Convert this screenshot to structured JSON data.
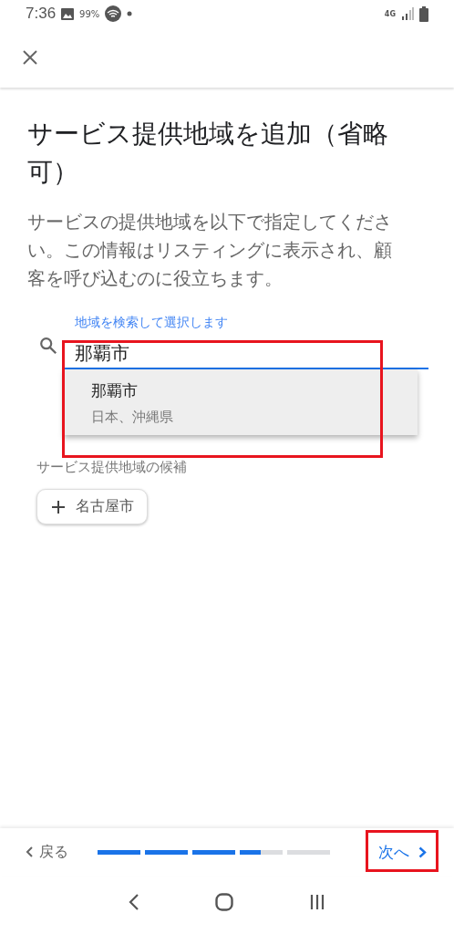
{
  "status_bar": {
    "time": "7:36",
    "battery_saver": "99%",
    "network": "4G"
  },
  "title": "サービス提供地域を追加（省略可）",
  "description": "サービスの提供地域を以下で指定してください。この情報はリスティングに表示され、顧客を呼び込むのに役立ちます。",
  "search": {
    "label": "地域を検索して選択します",
    "value": "那覇市",
    "highlighted": true,
    "suggestions": [
      {
        "name": "那覇市",
        "region": "日本、沖縄県"
      }
    ]
  },
  "candidates": {
    "heading": "サービス提供地域の候補",
    "chips": [
      "名古屋市"
    ]
  },
  "footer": {
    "back": "戻る",
    "next": "次へ",
    "next_highlighted": true,
    "progress": {
      "level": 0.7
    }
  }
}
